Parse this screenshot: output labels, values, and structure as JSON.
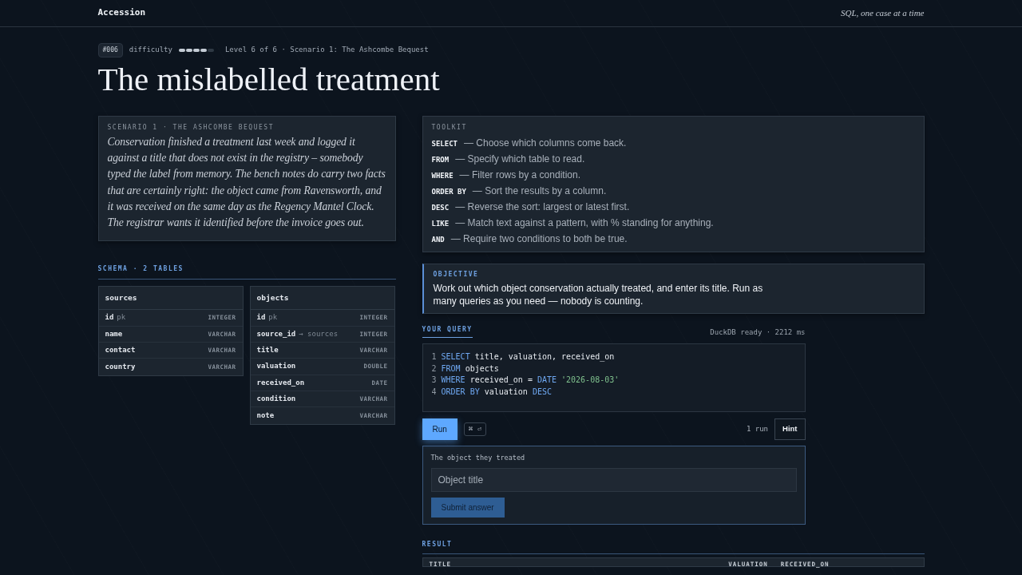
{
  "navbar": {
    "brand": "Accession",
    "tagline": "SQL, one case at a time"
  },
  "meta": {
    "badge": "#006",
    "difficulty_label": "difficulty",
    "difficulty": {
      "level": 0.8
    },
    "crumb": "Level 6 of 6 · Scenario 1: The Ashcombe Bequest"
  },
  "title": "The mislabelled treatment",
  "story": {
    "eyebrow": "SCENARIO 1 · THE ASHCOMBE BEQUEST",
    "text": "Conservation finished a treatment last week and logged it against a title that does not exist in the registry – somebody typed the label from memory. The bench notes do carry two facts that are certainly right: the object came from Ravensworth, and it was received on the same day as the Regency Mantel Clock. The registrar wants it identified before the invoice goes out."
  },
  "schema": {
    "heading": "SCHEMA · 2 TABLES",
    "tables": [
      {
        "name": "sources",
        "columns": [
          {
            "name": "id",
            "note": "pk",
            "type": "INTEGER"
          },
          {
            "name": "name",
            "type": "VARCHAR"
          },
          {
            "name": "contact",
            "type": "VARCHAR"
          },
          {
            "name": "country",
            "type": "VARCHAR"
          }
        ]
      },
      {
        "name": "objects",
        "columns": [
          {
            "name": "id",
            "note": "pk",
            "type": "INTEGER"
          },
          {
            "name": "source_id",
            "note": "→ sources",
            "type": "INTEGER"
          },
          {
            "name": "title",
            "type": "VARCHAR"
          },
          {
            "name": "valuation",
            "type": "DOUBLE"
          },
          {
            "name": "received_on",
            "type": "DATE"
          },
          {
            "name": "condition",
            "type": "VARCHAR"
          },
          {
            "name": "note",
            "type": "VARCHAR"
          }
        ]
      }
    ]
  },
  "toolkit": {
    "heading": "TOOLKIT",
    "items": [
      {
        "keyword": "SELECT",
        "text": "— Choose which columns come back."
      },
      {
        "keyword": "FROM",
        "text": "— Specify which table to read."
      },
      {
        "keyword": "WHERE",
        "text": "— Filter rows by a condition."
      },
      {
        "keyword": "ORDER BY",
        "text": "— Sort the results by a column."
      },
      {
        "keyword": "DESC",
        "text": "— Reverse the sort: largest or latest first."
      },
      {
        "keyword": "LIKE",
        "text": "— Match text against a pattern, with % standing for anything."
      },
      {
        "keyword": "AND",
        "text": "— Require two conditions to both be true."
      }
    ]
  },
  "objective": {
    "heading": "OBJECTIVE",
    "text": "Work out which object conservation actually treated, and enter its title. Run as many queries as you need — nobody is counting."
  },
  "query": {
    "tab": "YOUR QUERY",
    "status": "DuckDB ready · 2212 ms",
    "lines": [
      {
        "number": "1",
        "tokens": [
          {
            "kind": "keyword",
            "text": "SELECT"
          },
          {
            "kind": "plain",
            "text": "title, valuation, received_on"
          }
        ]
      },
      {
        "number": "2",
        "tokens": [
          {
            "kind": "keyword",
            "text": "FROM"
          },
          {
            "kind": "plain",
            "text": "objects"
          }
        ]
      },
      {
        "number": "3",
        "tokens": [
          {
            "kind": "keyword",
            "text": "WHERE"
          },
          {
            "kind": "plain",
            "text": "received_on ="
          },
          {
            "kind": "keyword",
            "text": "DATE"
          },
          {
            "kind": "string",
            "text": "'2026-08-03'"
          }
        ]
      },
      {
        "number": "4",
        "tokens": [
          {
            "kind": "keyword",
            "text": "ORDER BY"
          },
          {
            "kind": "plain",
            "text": "valuation"
          },
          {
            "kind": "keyword",
            "text": "DESC"
          }
        ]
      }
    ],
    "run_button": "Run",
    "shortcut": "⌘ ⏎",
    "run_count": "1 run",
    "hint_button": "Hint"
  },
  "answer": {
    "label": "The object they treated",
    "placeholder": "Object title",
    "submit": "Submit answer"
  },
  "result": {
    "heading": "RESULT",
    "columns": [
      "TITLE",
      "VALUATION",
      "RECEIVED_ON"
    ]
  }
}
